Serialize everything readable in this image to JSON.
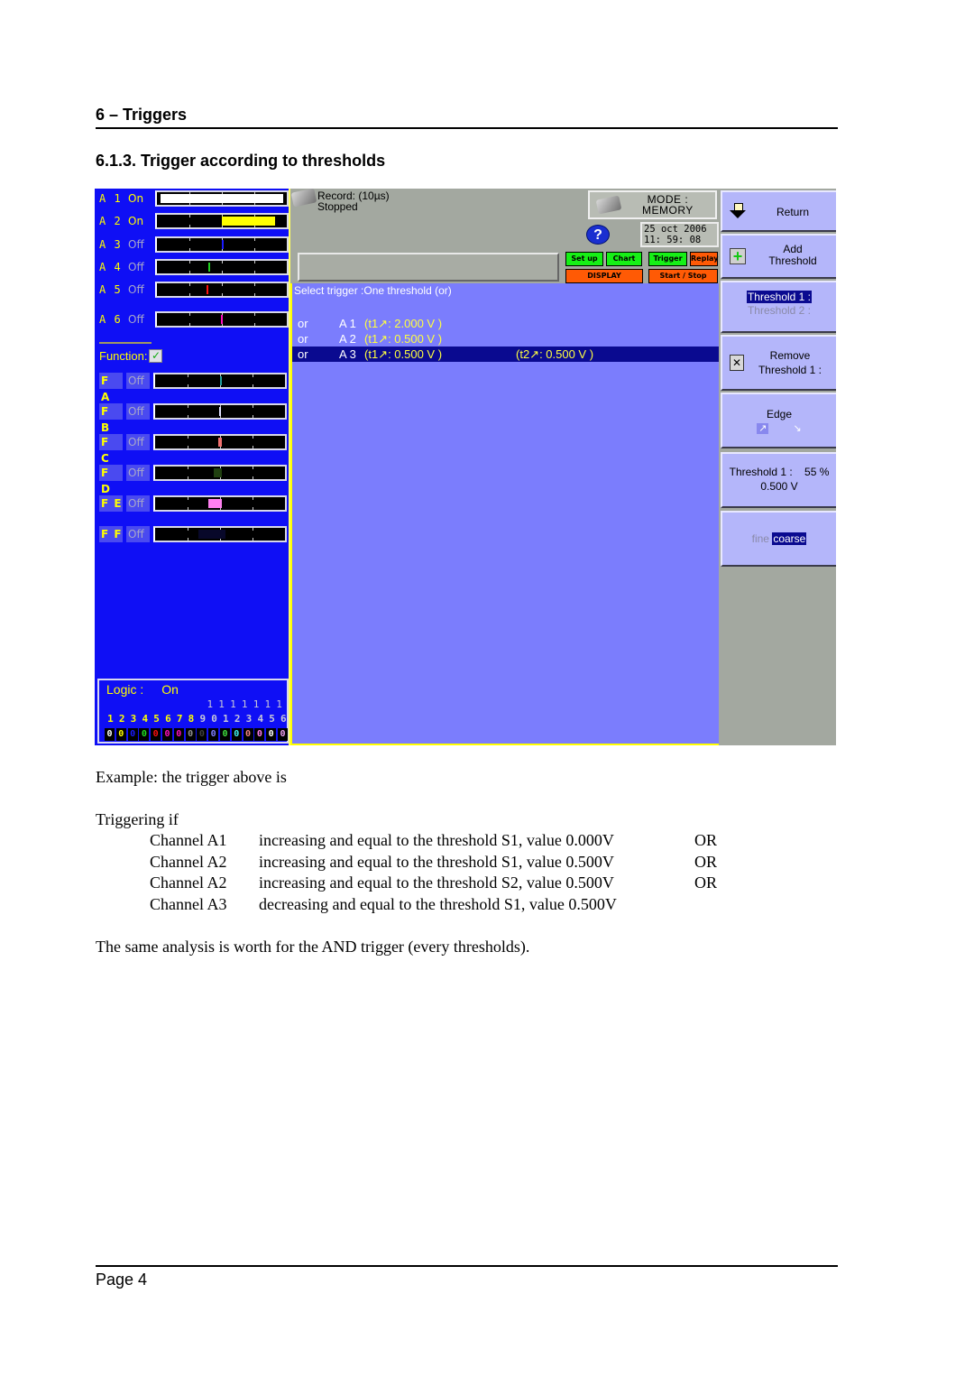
{
  "document": {
    "section_heading": "6 – Triggers",
    "subsection_heading": "6.1.3.  Trigger according to thresholds",
    "example_intro": "Example: the trigger above is",
    "triggering_if": "Triggering if",
    "conditions": [
      {
        "channel": "Channel A1",
        "description": "increasing and equal to the threshold S1, value 0.000V",
        "conjunction": "OR"
      },
      {
        "channel": "Channel A2",
        "description": "increasing and equal to the threshold S1, value 0.500V",
        "conjunction": "OR"
      },
      {
        "channel": "Channel A2",
        "description": "increasing and equal to the threshold S2, value 0.500V",
        "conjunction": "OR"
      },
      {
        "channel": "Channel A3",
        "description": "decreasing and equal to the threshold S1, value 0.500V",
        "conjunction": ""
      }
    ],
    "closing_note": "The same analysis is worth for the AND trigger (every thresholds).",
    "page_label": "Page 4"
  },
  "device": {
    "channels": [
      {
        "name": "A 1",
        "state": "On",
        "marker_color": "#ffffff",
        "marker_from": 0.03,
        "marker_to": 0.97
      },
      {
        "name": "A 2",
        "state": "On",
        "marker_color": "#ffff00",
        "marker_from": 0.5,
        "marker_to": 0.91
      },
      {
        "name": "A 3",
        "state": "Off",
        "marker_color": "#1a1aff",
        "marker_from": 0.5,
        "marker_to": 0.505
      },
      {
        "name": "A 4",
        "state": "Off",
        "marker_color": "#20d020",
        "marker_from": 0.395,
        "marker_to": 0.4
      },
      {
        "name": "A 5",
        "state": "Off",
        "marker_color": "#ff1010",
        "marker_from": 0.385,
        "marker_to": 0.39
      },
      {
        "name": "A 6",
        "state": "Off",
        "marker_color": "#ff10c0",
        "marker_from": 0.49,
        "marker_to": 0.505
      }
    ],
    "function_label": "Function:",
    "function_checked": true,
    "functions": [
      {
        "name": "F A",
        "state": "Off",
        "marker_color": "#20a0a0",
        "marker_from": 0.5,
        "marker_to": 0.51
      },
      {
        "name": "F B",
        "state": "Off",
        "marker_color": "#e0e0ff",
        "marker_from": 0.49,
        "marker_to": 0.505
      },
      {
        "name": "F C",
        "state": "Off",
        "marker_color": "#f07070",
        "marker_from": 0.485,
        "marker_to": 0.515
      },
      {
        "name": "F D",
        "state": "Off",
        "marker_color": "#204010",
        "marker_from": 0.45,
        "marker_to": 0.515
      },
      {
        "name": "F E",
        "state": "Off",
        "marker_color": "#ff80f0",
        "marker_from": 0.41,
        "marker_to": 0.515
      },
      {
        "name": "F F",
        "state": "Off",
        "marker_color": "#08082a",
        "marker_from": 0.33,
        "marker_to": 0.54
      }
    ],
    "logic": {
      "label": "Logic :",
      "state": "On",
      "tens": [
        "1",
        "1",
        "1",
        "1",
        "1",
        "1",
        "1"
      ],
      "numbers": [
        "1",
        "2",
        "3",
        "4",
        "5",
        "6",
        "7",
        "8",
        "9",
        "0",
        "1",
        "2",
        "3",
        "4",
        "5",
        "6"
      ],
      "number_colors": [
        "#ffff00",
        "#ffff00",
        "#ffff00",
        "#ffff00",
        "#ffff00",
        "#ffff00",
        "#ffff00",
        "#ffff00",
        "#c8c8d8",
        "#c8c8d8",
        "#c8c8d8",
        "#c8c8d8",
        "#c8c8d8",
        "#c8c8d8",
        "#c8c8d8",
        "#c8c8d8"
      ],
      "bits": [
        "0",
        "0",
        "0",
        "0",
        "0",
        "0",
        "0",
        "0",
        "0",
        "0",
        "0",
        "0",
        "0",
        "0",
        "0",
        "0"
      ],
      "bit_colors": [
        "#ffffff",
        "#ffff00",
        "#1a1aff",
        "#20e020",
        "#ff1010",
        "#ff10c0",
        "#ff10c0",
        "#909090",
        "#404040",
        "#8080ff",
        "#40e040",
        "#40f0f0",
        "#f08080",
        "#ff80f0",
        "#ffffff",
        "#f0a0f0"
      ]
    },
    "record_line1": "Record: (10µs)",
    "record_line2": "Stopped",
    "mode_line1": "MODE :",
    "mode_line2": "MEMORY",
    "date": "25 oct 2006",
    "time": "11: 59: 08",
    "menu": {
      "setup": "Set up",
      "chart": "Chart",
      "trigger": "Trigger",
      "replay": "Replay",
      "display": "DISPLAY",
      "start_stop": "Start / Stop"
    },
    "select_trigger_title": "Select trigger :One threshold (or)",
    "trigger_rows": [
      {
        "op": "or",
        "channel": "A 1",
        "t1": "(t1↗: 2.000 V )",
        "t2": "",
        "selected": false
      },
      {
        "op": "or",
        "channel": "A 2",
        "t1": "(t1↗: 0.500 V )",
        "t2": "",
        "selected": false
      },
      {
        "op": "or",
        "channel": "A 3",
        "t1": "(t1↗: 0.500 V )",
        "t2": "(t2↗: 0.500 V )",
        "selected": true
      }
    ],
    "softkeys": {
      "return": "Return",
      "add_threshold_1": "Add",
      "add_threshold_2": "Threshold",
      "threshold_1": "Threshold 1 :",
      "threshold_2": "Threshold 2 :",
      "remove_1": "Remove",
      "remove_2": "Threshold 1 :",
      "edge": "Edge",
      "edge_rising": "↗",
      "edge_falling": "↘",
      "threshold_value_label": "Threshold 1 :",
      "threshold_percent": "55 %",
      "threshold_volts": "0.500 V",
      "fine": "fine",
      "coarse": "coarse"
    }
  }
}
